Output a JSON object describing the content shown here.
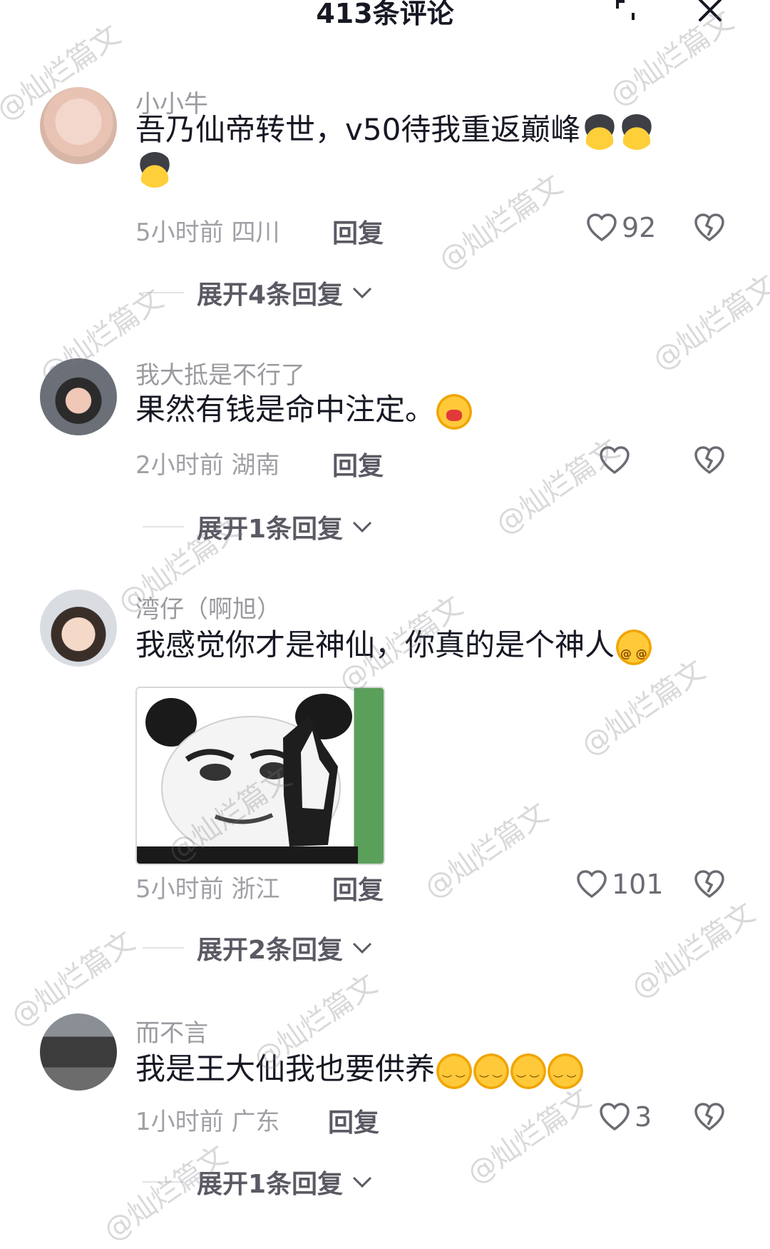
{
  "header": {
    "title": "413条评论",
    "expand_icon": "fullscreen-icon",
    "close_icon": "close-icon"
  },
  "comments": [
    {
      "username": "小小牛",
      "text": "吾乃仙帝转世，v50待我重返巅峰",
      "emojis": [
        "helmet",
        "helmet",
        "helmet"
      ],
      "time": "5小时前",
      "location": "四川",
      "reply_label": "回复",
      "likes": "92",
      "expand_label": "展开4条回复"
    },
    {
      "username": "我大抵是不行了",
      "text": "果然有钱是命中注定。",
      "emojis": [
        "cry"
      ],
      "time": "2小时前",
      "location": "湖南",
      "reply_label": "回复",
      "likes": "",
      "expand_label": "展开1条回复"
    },
    {
      "username": "湾仔（啊旭）",
      "text": "我感觉你才是神仙，你真的是个神人",
      "emojis": [
        "dizzy"
      ],
      "sticker": "panda-meme",
      "time": "5小时前",
      "location": "浙江",
      "reply_label": "回复",
      "likes": "101",
      "expand_label": "展开2条回复"
    },
    {
      "username": "而不言",
      "text": "我是王大仙我也要供养",
      "emojis": [
        "sly",
        "sly",
        "sly",
        "sly"
      ],
      "time": "1小时前",
      "location": "广东",
      "reply_label": "回复",
      "likes": "3",
      "expand_label": "展开1条回复"
    }
  ],
  "watermark": "@灿烂篇文",
  "colors": {
    "text": "#161823",
    "meta": "#a0a0a6",
    "accent_emoji": "#ffc93a"
  }
}
